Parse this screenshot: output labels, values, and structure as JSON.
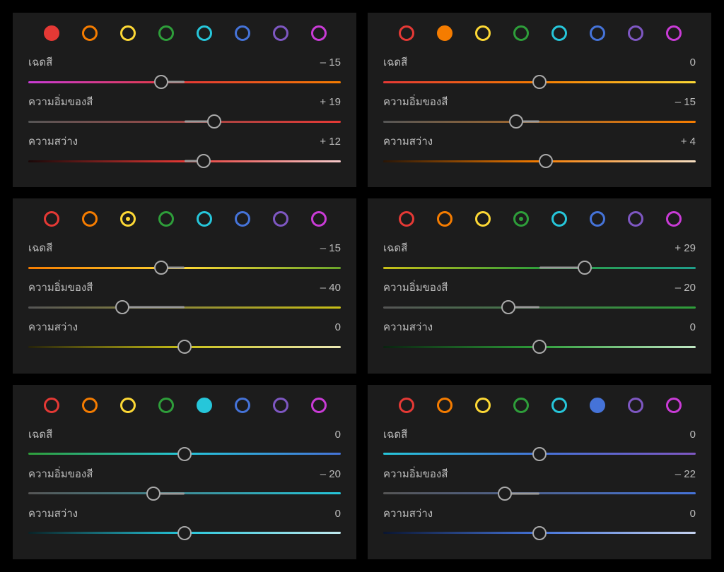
{
  "colors": {
    "red": "#e53935",
    "orange": "#f57c00",
    "yellow": "#fdd835",
    "green": "#2e9e3a",
    "aqua": "#26c6da",
    "blue": "#4573d8",
    "purple": "#7e57c2",
    "magenta": "#c93bd6"
  },
  "colorOrder": [
    "red",
    "orange",
    "yellow",
    "green",
    "aqua",
    "blue",
    "purple",
    "magenta"
  ],
  "labels": {
    "hue": "เฉดสี",
    "saturation": "ความอิ่มของสี",
    "luminance": "ความสว่าง"
  },
  "hueGradients": {
    "red": [
      "#c93bd6",
      "#e53935",
      "#f57c00"
    ],
    "orange": [
      "#e53935",
      "#f57c00",
      "#fdd835"
    ],
    "yellow": [
      "#f57c00",
      "#fdd835",
      "#6aa52a"
    ],
    "green": [
      "#c9c017",
      "#2e9e3a",
      "#1f9e8a"
    ],
    "aqua": [
      "#2e9e3a",
      "#26c6da",
      "#4573d8"
    ],
    "blue": [
      "#26c6da",
      "#4573d8",
      "#7e57c2"
    ]
  },
  "satGradients": {
    "red": [
      "#555",
      "#e53935"
    ],
    "orange": [
      "#555",
      "#f57c00"
    ],
    "yellow": [
      "#555",
      "#c9c017"
    ],
    "green": [
      "#555",
      "#2e9e3a"
    ],
    "aqua": [
      "#555",
      "#26c6da"
    ],
    "blue": [
      "#555",
      "#4573d8"
    ]
  },
  "lumGradients": {
    "red": [
      "#1a0808",
      "#e53935",
      "#f7caca"
    ],
    "orange": [
      "#2a1606",
      "#f57c00",
      "#f7dfc2"
    ],
    "yellow": [
      "#26230a",
      "#c9c017",
      "#ece9b5"
    ],
    "green": [
      "#0a2310",
      "#2e9e3a",
      "#c1e8c5"
    ],
    "aqua": [
      "#0a2226",
      "#26c6da",
      "#c1e9ee"
    ],
    "blue": [
      "#0a1530",
      "#4573d8",
      "#c5d2ef"
    ]
  },
  "panels": [
    {
      "active": "red",
      "hue": -15,
      "sat": 19,
      "lum": 12
    },
    {
      "active": "orange",
      "hue": 0,
      "sat": -15,
      "lum": 4
    },
    {
      "active": "yellow",
      "hue": -15,
      "sat": -40,
      "lum": 0
    },
    {
      "active": "green",
      "hue": 29,
      "sat": -20,
      "lum": 0
    },
    {
      "active": "aqua",
      "hue": 0,
      "sat": -20,
      "lum": 0
    },
    {
      "active": "blue",
      "hue": 0,
      "sat": -22,
      "lum": 0
    }
  ]
}
